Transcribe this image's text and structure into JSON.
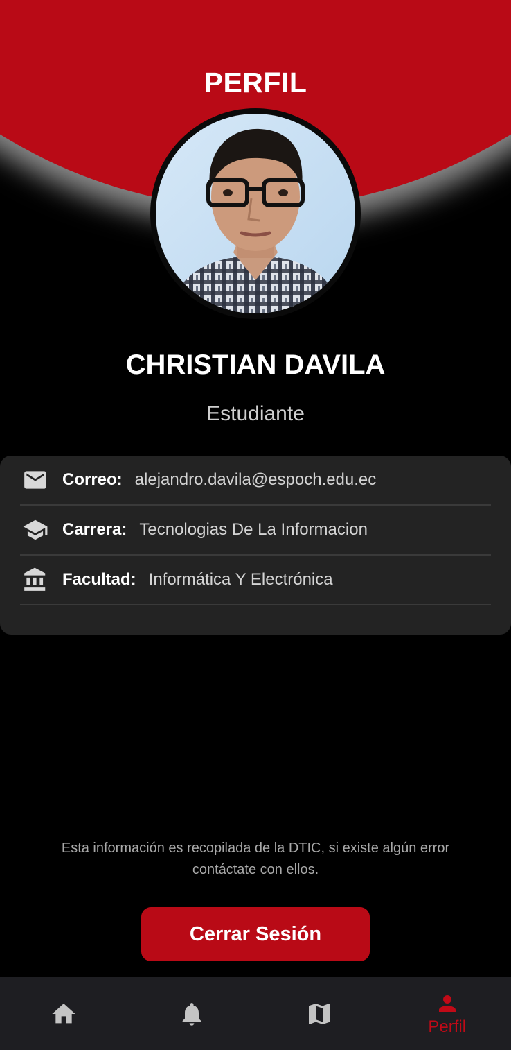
{
  "header": {
    "title": "PERFIL"
  },
  "user": {
    "name": "CHRISTIAN DAVILA",
    "role": "Estudiante"
  },
  "info": [
    {
      "icon": "mail-icon",
      "label": "Correo:",
      "value": "alejandro.davila@espoch.edu.ec"
    },
    {
      "icon": "graduation-cap-icon",
      "label": "Carrera:",
      "value": "Tecnologias De La Informacion"
    },
    {
      "icon": "institution-icon",
      "label": "Facultad:",
      "value": "Informática Y Electrónica"
    }
  ],
  "disclaimer": "Esta información es recopilada de la DTIC, si existe algún error contáctate con ellos.",
  "logout_label": "Cerrar Sesión",
  "nav": [
    {
      "icon": "home-icon",
      "label": ""
    },
    {
      "icon": "bell-icon",
      "label": ""
    },
    {
      "icon": "map-icon",
      "label": ""
    },
    {
      "icon": "person-icon",
      "label": "Perfil",
      "active": true
    }
  ],
  "colors": {
    "accent": "#b90a16",
    "background": "#000000",
    "card": "#232323",
    "nav": "#1e1e22"
  }
}
